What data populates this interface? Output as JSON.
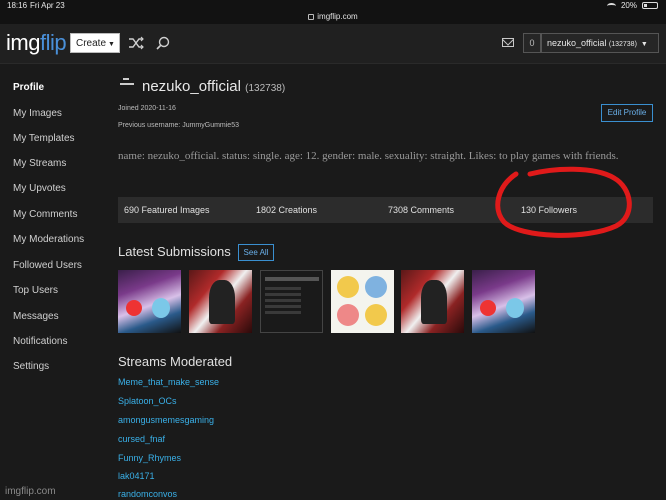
{
  "status_bar": {
    "time": "18:16",
    "date": "Fri Apr 23",
    "battery": "20%",
    "url": "imgflip.com"
  },
  "header": {
    "logo_part1": "img",
    "logo_part2": "flip",
    "create_label": "Create",
    "notif_count": "0",
    "user_label": "nezuko_official",
    "user_points": "(132738)"
  },
  "sidebar": {
    "items": [
      "Profile",
      "My Images",
      "My Templates",
      "My Streams",
      "My Upvotes",
      "My Comments",
      "My Moderations",
      "Followed Users",
      "Top Users",
      "Messages",
      "Notifications",
      "Settings"
    ]
  },
  "profile": {
    "username": "nezuko_official",
    "points": "(132738)",
    "joined": "Joined 2020-11-16",
    "previous_username": "Previous username: JummyGummie53",
    "edit_label": "Edit Profile",
    "bio": "name: nezuko_official. status: single. age: 12. gender: male. sexuality: straight. Likes: to play games with friends."
  },
  "stats": {
    "featured": "690 Featured Images",
    "creations": "1802 Creations",
    "comments": "7308 Comments",
    "followers": "130 Followers"
  },
  "latest": {
    "title": "Latest Submissions",
    "see_all": "See All"
  },
  "streams": {
    "title": "Streams Moderated",
    "items": [
      "Meme_that_make_sense",
      "Splatoon_OCs",
      "amongusmemesgaming",
      "cursed_fnaf",
      "Funny_Rhymes",
      "lak04171",
      "randomconvos"
    ]
  },
  "footer": {
    "watermark": "imgflip.com"
  },
  "annotation": {
    "color": "#e01a1a"
  }
}
